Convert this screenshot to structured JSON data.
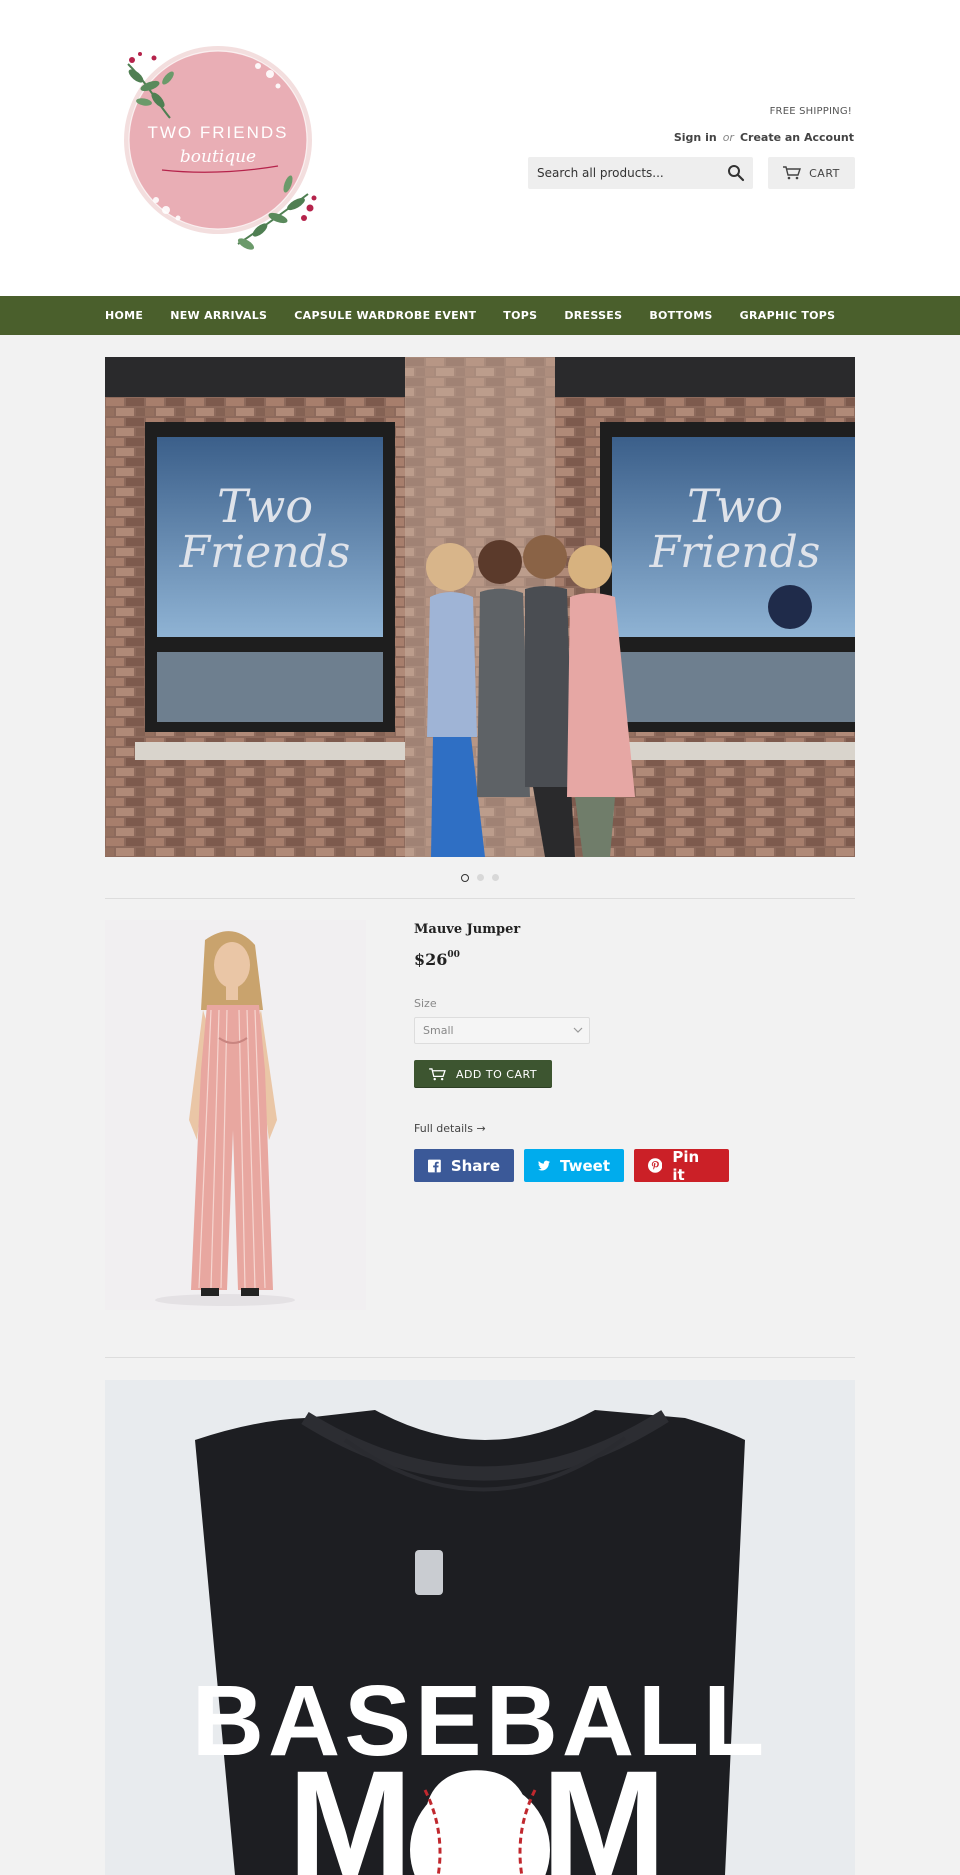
{
  "header": {
    "logo": {
      "title": "TWO FRIENDS",
      "script": "boutique",
      "colors": {
        "circle": "#e9aeb5",
        "leaf": "#4f7f52",
        "berry": "#b5234b"
      }
    },
    "shipping_text": "FREE SHIPPING!",
    "sign_in": "Sign in",
    "or_text": "or",
    "create_account": "Create an Account",
    "search_placeholder": "Search all products...",
    "cart_label": "CART"
  },
  "nav": {
    "color": "#4a5f2c",
    "items": [
      "HOME",
      "NEW ARRIVALS",
      "CAPSULE WARDROBE EVENT",
      "TOPS",
      "DRESSES",
      "BOTTOMS",
      "GRAPHIC TOPS"
    ]
  },
  "hero": {
    "window_text_line1": "Two",
    "window_text_line2": "Friends",
    "slides_total": 3,
    "active_slide": 1
  },
  "product": {
    "title": "Mauve Jumper",
    "price_main": "$26",
    "price_cents": "00",
    "size_label": "Size",
    "size_selected": "Small",
    "add_to_cart": "ADD TO CART",
    "full_details": "Full details →",
    "share_labels": {
      "facebook": "Share",
      "twitter": "Tweet",
      "pinterest": "Pin it"
    },
    "share_colors": {
      "facebook": "#3b5998",
      "twitter": "#00aced",
      "pinterest": "#cb2027"
    },
    "button_color": "#3d5530"
  },
  "feature": {
    "shirt_line1": "BASEBALL",
    "shirt_line2": "MOM"
  }
}
